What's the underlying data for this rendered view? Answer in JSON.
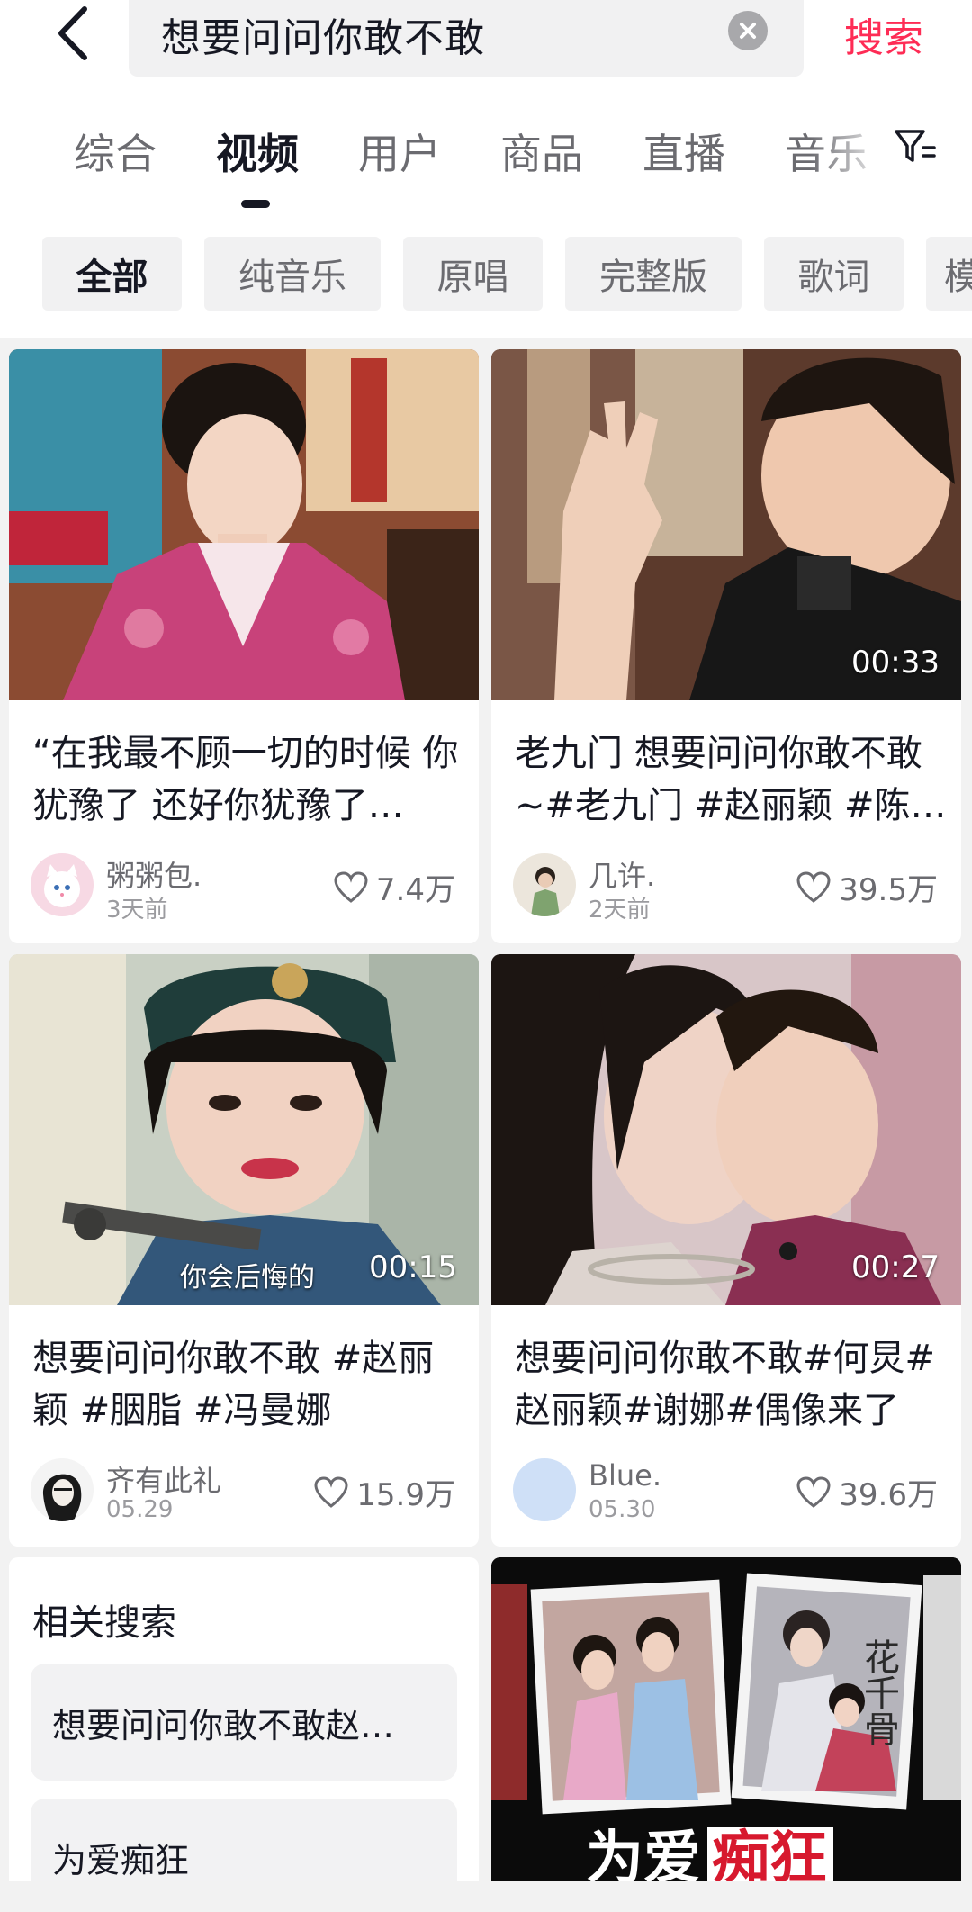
{
  "search": {
    "query": "想要问问你敢不敢",
    "submit_label": "搜索"
  },
  "tabs": [
    {
      "label": "综合"
    },
    {
      "label": "视频"
    },
    {
      "label": "用户"
    },
    {
      "label": "商品"
    },
    {
      "label": "直播"
    },
    {
      "label": "音乐"
    }
  ],
  "chips": [
    {
      "label": "全部"
    },
    {
      "label": "纯音乐"
    },
    {
      "label": "原唱"
    },
    {
      "label": "完整版"
    },
    {
      "label": "歌词"
    },
    {
      "label": "模"
    }
  ],
  "videos": [
    {
      "caption": "“在我最不顾一切的时候 你犹豫了 还好你犹豫了…",
      "duration": "",
      "author": "粥粥包.",
      "date": "3天前",
      "likes": "7.4万",
      "avatar_icon": "cartoon-cat-avatar-icon"
    },
    {
      "caption": "老九门 想要问问你敢不敢 ~#老九门 #赵丽颖 #陈…",
      "duration": "00:33",
      "author": "几许.",
      "date": "2天前",
      "likes": "39.5万",
      "avatar_icon": "portrait-avatar-icon"
    },
    {
      "caption": "想要问问你敢不敢 #赵丽颖 #胭脂 #冯曼娜",
      "duration": "00:15",
      "overlay_text": "你会后悔的",
      "author": "齐有此礼",
      "date": "05.29",
      "likes": "15.9万",
      "avatar_icon": "sketch-avatar-icon"
    },
    {
      "caption": "想要问问你敢不敢#何炅#赵丽颖#谢娜#偶像来了",
      "duration": "00:27",
      "author": "Blue.",
      "date": "05.30",
      "likes": "39.6万",
      "avatar_icon": "blank-avatar-icon"
    }
  ],
  "related": {
    "title": "相关搜索",
    "items": [
      {
        "label": "想要问问你敢不敢赵…"
      },
      {
        "label": "为爱痴狂"
      }
    ]
  },
  "poster": {
    "banner_text_white": "为爱",
    "banner_text_red": "痴狂",
    "calligraphy": "花千骨"
  },
  "colors": {
    "accent": "#fe2c55",
    "text_primary": "#161823",
    "text_secondary": "#6b6b70"
  }
}
